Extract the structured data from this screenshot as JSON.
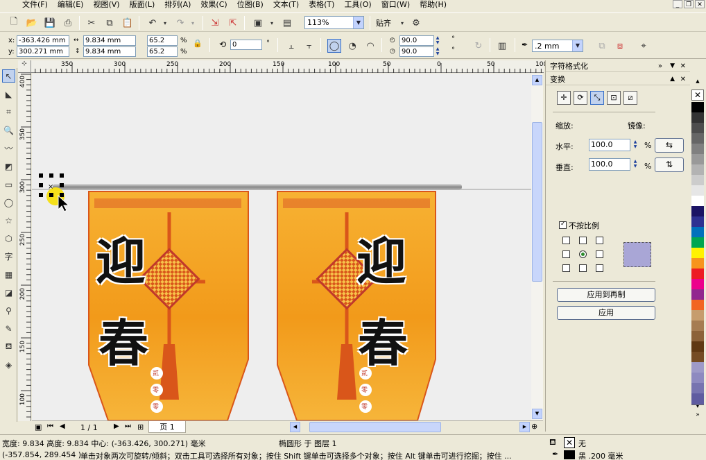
{
  "menu": [
    "文件(F)",
    "编辑(E)",
    "视图(V)",
    "版面(L)",
    "排列(A)",
    "效果(C)",
    "位图(B)",
    "文本(T)",
    "表格(T)",
    "工具(O)",
    "窗口(W)",
    "帮助(H)"
  ],
  "toolbar": {
    "zoom": "113%",
    "snap_label": "贴齐"
  },
  "props": {
    "x_label": "x:",
    "x_value": "-363.426 mm",
    "y_label": "y:",
    "y_value": "300.271 mm",
    "w_value": "9.834 mm",
    "h_value": "9.834 mm",
    "scale_x": "65.2",
    "scale_y": "65.2",
    "pct": "%",
    "rotation": "0",
    "deg": "°",
    "start_angle": "90.0",
    "end_angle": "90.0",
    "outline_width": ".2 mm"
  },
  "ruler": {
    "h_ticks": [
      "350",
      "300",
      "250",
      "200",
      "150",
      "100",
      "50",
      "0",
      "50",
      "100"
    ],
    "v_ticks": [
      "400",
      "350",
      "300",
      "250",
      "200",
      "150",
      "100"
    ],
    "unit": "毫米"
  },
  "banner": {
    "text1": "迎",
    "text2": "春",
    "small1": "贰",
    "small2": "零",
    "small3": "零"
  },
  "docker": {
    "header_char_format": "字符格式化",
    "header_transform": "变换",
    "scale_label": "缩放:",
    "mirror_label": "镜像:",
    "h_label": "水平:",
    "h_value": "100.0",
    "v_label": "垂直:",
    "v_value": "100.0",
    "pct": "%",
    "nonprop_label": "不按比例",
    "apply_dup": "应用到再制",
    "apply": "应用"
  },
  "pager": {
    "current": "1 / 1",
    "tab": "页 1"
  },
  "status": {
    "line1_left": "宽度: 9.834  高度: 9.834  中心: (-363.426, 300.271)  毫米",
    "line1_mid": "椭圆形 于 图层 1",
    "fill_label": "无",
    "line2_left": "(-357.854, 289.454 )",
    "line2_mid": "单击对象两次可旋转/倾斜；双击工具可选择所有对象；按住 Shift 键单击可选择多个对象；按住 Alt 键单击可进行挖掘；按住 ...",
    "outline_label": "黑  .200 毫米"
  },
  "colors": {
    "accent": "#316ac5",
    "banner_orange": "#f29a1a",
    "banner_dark": "#d9561a",
    "palette": [
      "#000000",
      "#333333",
      "#4d4d4d",
      "#666666",
      "#808080",
      "#999999",
      "#b3b3b3",
      "#cccccc",
      "#e6e6e6",
      "#ffffff",
      "#1b1464",
      "#2e3192",
      "#0071bc",
      "#00a651",
      "#fff200",
      "#f7941d",
      "#ed1c24",
      "#ec008c",
      "#92278f",
      "#f26522",
      "#c69c6d",
      "#a67c52",
      "#8c6239",
      "#603913",
      "#754c24",
      "#9e9ac8",
      "#8e8ac0",
      "#7774b0",
      "#5f5ca0"
    ]
  }
}
